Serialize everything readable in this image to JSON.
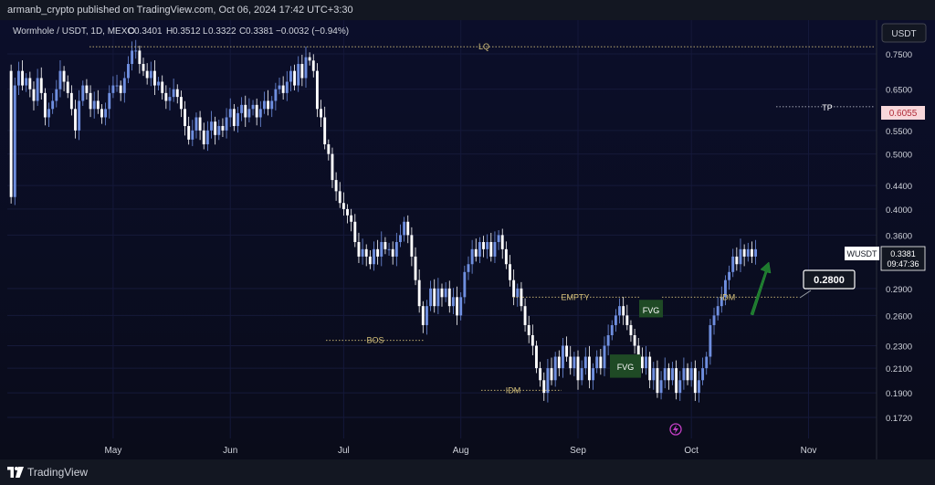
{
  "header": {
    "publisher": "armanb_crypto published on TradingView.com, Oct 06, 2024 17:42 UTC+3:30"
  },
  "legend": {
    "symbol": "Wormhole / USDT, 1D, MEXC",
    "o_label": "O",
    "o": "0.3401",
    "h_label": "H",
    "h": "0.3512",
    "l_label": "L",
    "l": "0.3322",
    "c_label": "C",
    "c": "0.3381",
    "change": "−0.0032 (−0.94%)"
  },
  "currency_button": "USDT",
  "price_tag": {
    "symbol": "WUSDT",
    "price": "0.3381",
    "countdown": "09:47:36"
  },
  "tp_price_tag": "0.6055",
  "target_box": "0.2800",
  "footer": {
    "brand": "TradingView"
  },
  "colors": {
    "background_top": "#0b0e2a",
    "background_bottom": "#0a0c1a",
    "candle_up": "#6f8fe0",
    "candle_down": "#ffffff",
    "annotation": "#d4c07a",
    "arrow": "#1e7a2e",
    "fvg_box": "#1f4a25",
    "tp_tag": "#f8d7da"
  },
  "chart_data": {
    "type": "candlestick",
    "title": "Wormhole / USDT, 1D, MEXC",
    "y_scale": "log",
    "ylim": [
      0.158,
      0.86
    ],
    "y_ticks": [
      "0.7500",
      "0.6500",
      "0.5500",
      "0.5000",
      "0.4400",
      "0.4000",
      "0.3600",
      "0.2900",
      "0.2600",
      "0.2300",
      "0.2100",
      "0.1900",
      "0.1720"
    ],
    "x_ticks": [
      {
        "label": "May",
        "date": "2024-05-01"
      },
      {
        "label": "Jun",
        "date": "2024-06-01"
      },
      {
        "label": "Jul",
        "date": "2024-07-01"
      },
      {
        "label": "Aug",
        "date": "2024-08-01"
      },
      {
        "label": "Sep",
        "date": "2024-09-01"
      },
      {
        "label": "Oct",
        "date": "2024-10-01"
      },
      {
        "label": "Nov",
        "date": "2024-11-01"
      }
    ],
    "x_range": [
      "2024-04-03",
      "2024-11-19"
    ],
    "start_date": "2024-04-03",
    "closes": [
      0.7,
      0.42,
      0.66,
      0.7,
      0.66,
      0.68,
      0.65,
      0.62,
      0.68,
      0.64,
      0.58,
      0.6,
      0.62,
      0.65,
      0.7,
      0.67,
      0.64,
      0.6,
      0.55,
      0.62,
      0.66,
      0.64,
      0.6,
      0.62,
      0.6,
      0.58,
      0.6,
      0.64,
      0.66,
      0.66,
      0.64,
      0.68,
      0.72,
      0.76,
      0.76,
      0.72,
      0.7,
      0.68,
      0.7,
      0.66,
      0.67,
      0.64,
      0.62,
      0.63,
      0.65,
      0.63,
      0.6,
      0.56,
      0.53,
      0.55,
      0.58,
      0.55,
      0.52,
      0.55,
      0.57,
      0.54,
      0.56,
      0.55,
      0.58,
      0.6,
      0.56,
      0.59,
      0.61,
      0.58,
      0.6,
      0.61,
      0.58,
      0.6,
      0.62,
      0.6,
      0.62,
      0.65,
      0.66,
      0.64,
      0.67,
      0.7,
      0.66,
      0.72,
      0.68,
      0.74,
      0.73,
      0.7,
      0.6,
      0.58,
      0.52,
      0.5,
      0.45,
      0.43,
      0.41,
      0.4,
      0.39,
      0.38,
      0.35,
      0.33,
      0.34,
      0.33,
      0.32,
      0.34,
      0.33,
      0.35,
      0.34,
      0.34,
      0.33,
      0.35,
      0.36,
      0.38,
      0.36,
      0.33,
      0.3,
      0.27,
      0.25,
      0.27,
      0.29,
      0.27,
      0.29,
      0.28,
      0.29,
      0.27,
      0.28,
      0.26,
      0.28,
      0.31,
      0.32,
      0.34,
      0.33,
      0.35,
      0.34,
      0.35,
      0.33,
      0.35,
      0.36,
      0.34,
      0.32,
      0.3,
      0.28,
      0.29,
      0.27,
      0.25,
      0.24,
      0.23,
      0.21,
      0.2,
      0.19,
      0.21,
      0.2,
      0.22,
      0.21,
      0.23,
      0.22,
      0.21,
      0.22,
      0.2,
      0.21,
      0.22,
      0.2,
      0.21,
      0.22,
      0.21,
      0.23,
      0.24,
      0.25,
      0.26,
      0.27,
      0.26,
      0.25,
      0.24,
      0.23,
      0.22,
      0.21,
      0.22,
      0.2,
      0.21,
      0.19,
      0.2,
      0.21,
      0.2,
      0.21,
      0.19,
      0.2,
      0.21,
      0.2,
      0.21,
      0.19,
      0.2,
      0.21,
      0.22,
      0.25,
      0.26,
      0.27,
      0.28,
      0.3,
      0.31,
      0.33,
      0.32,
      0.34,
      0.33,
      0.34,
      0.33,
      0.34
    ]
  },
  "annotations": {
    "lq": "LQ",
    "tp": "TP",
    "bos": "BOS",
    "idm1": "IDM",
    "idm2": "IDM",
    "empty": "EMPTY",
    "fvg1": "FVG",
    "fvg2": "FVG"
  }
}
